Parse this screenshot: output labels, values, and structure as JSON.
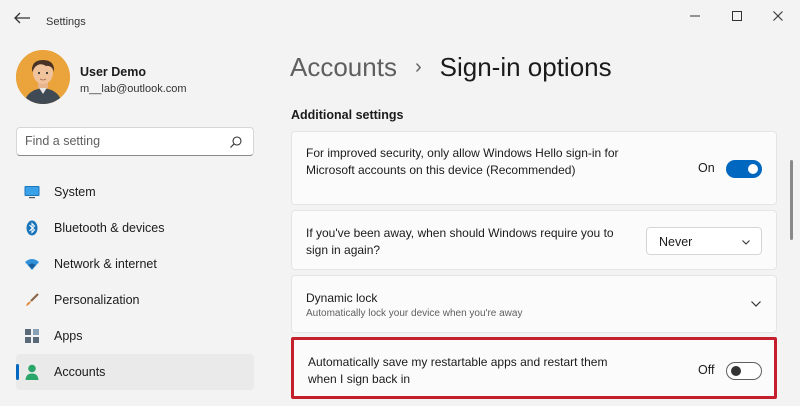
{
  "window": {
    "title": "Settings",
    "controls": {
      "minimize": "minimize",
      "maximize": "maximize",
      "close": "close"
    }
  },
  "profile": {
    "name": "User Demo",
    "email": "m__lab@outlook.com"
  },
  "search": {
    "placeholder": "Find a setting"
  },
  "sidebar": {
    "items": [
      {
        "label": "System",
        "icon": "monitor-icon",
        "active": false
      },
      {
        "label": "Bluetooth & devices",
        "icon": "bluetooth-icon",
        "active": false
      },
      {
        "label": "Network & internet",
        "icon": "wifi-icon",
        "active": false
      },
      {
        "label": "Personalization",
        "icon": "brush-icon",
        "active": false
      },
      {
        "label": "Apps",
        "icon": "apps-icon",
        "active": false
      },
      {
        "label": "Accounts",
        "icon": "person-icon",
        "active": true
      }
    ]
  },
  "breadcrumb": {
    "parent": "Accounts",
    "separator": "›",
    "current": "Sign-in options"
  },
  "section": {
    "title": "Additional settings"
  },
  "cards": {
    "hello": {
      "text": "For improved security, only allow Windows Hello sign-in for Microsoft accounts on this device (Recommended)",
      "state_label": "On",
      "enabled": true
    },
    "away": {
      "text": "If you've been away, when should Windows require you to sign in again?",
      "selected": "Never"
    },
    "dynamic_lock": {
      "title": "Dynamic lock",
      "subtitle": "Automatically lock your device when you're away"
    },
    "restart_apps": {
      "text": "Automatically save my restartable apps and restart them when I sign back in",
      "state_label": "Off",
      "enabled": false
    }
  },
  "colors": {
    "accent": "#0067c0",
    "highlight": "#c41f2c",
    "background": "#f3f3f3"
  }
}
